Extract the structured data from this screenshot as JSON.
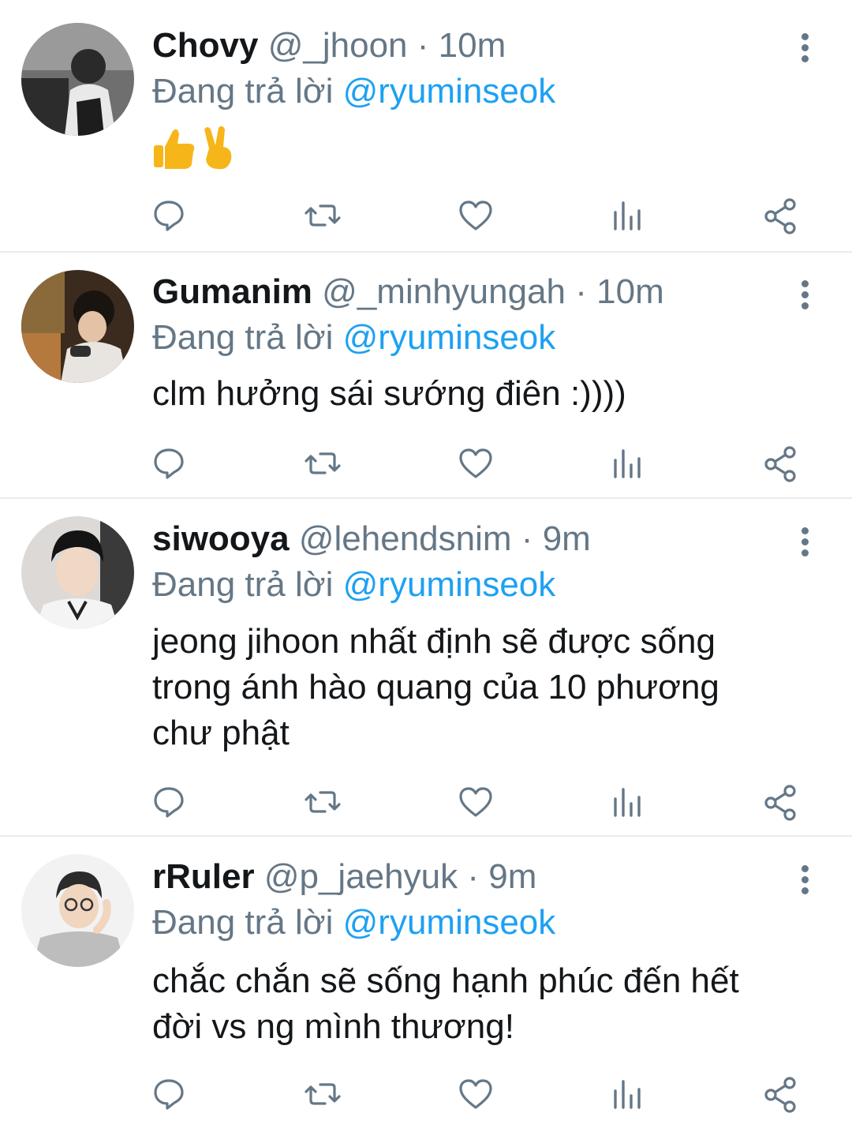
{
  "tweets": [
    {
      "name": "Chovy",
      "handle": "@_jhoon",
      "separator": "·",
      "time": "10m",
      "reply_prefix": "Đang trả lời",
      "reply_to": "@ryuminseok",
      "text_lines": [],
      "emojis": [
        "thumbs-up-icon",
        "victory-hand-icon"
      ]
    },
    {
      "name": "Gumanim",
      "handle": "@_minhyungah",
      "separator": "·",
      "time": "10m",
      "reply_prefix": "Đang trả lời",
      "reply_to": "@ryuminseok",
      "text_lines": [
        "clm hưởng sái sướng điên :))))"
      ]
    },
    {
      "name": "siwooya",
      "handle": "@lehendsnim",
      "separator": "·",
      "time": "9m",
      "reply_prefix": "Đang trả lời",
      "reply_to": "@ryuminseok",
      "text_lines": [
        "jeong jihoon nhất định sẽ được sống",
        "trong ánh hào quang của 10 phương",
        "chư phật"
      ]
    },
    {
      "name": "rRuler",
      "handle": "@p_jaehyuk",
      "separator": "·",
      "time": "9m",
      "reply_prefix": "Đang trả lời",
      "reply_to": "@ryuminseok",
      "text_lines": [
        "chắc chắn sẽ sống hạnh phúc đến hết",
        "đời vs ng mình thương!"
      ]
    }
  ],
  "action_icons": [
    "reply-icon",
    "retweet-icon",
    "like-icon",
    "analytics-icon",
    "share-icon"
  ],
  "colors": {
    "text": "#14171a",
    "secondary": "#657786",
    "mention": "#1da1f2",
    "divider": "#e6ecf0",
    "emoji": "#f6b619"
  }
}
